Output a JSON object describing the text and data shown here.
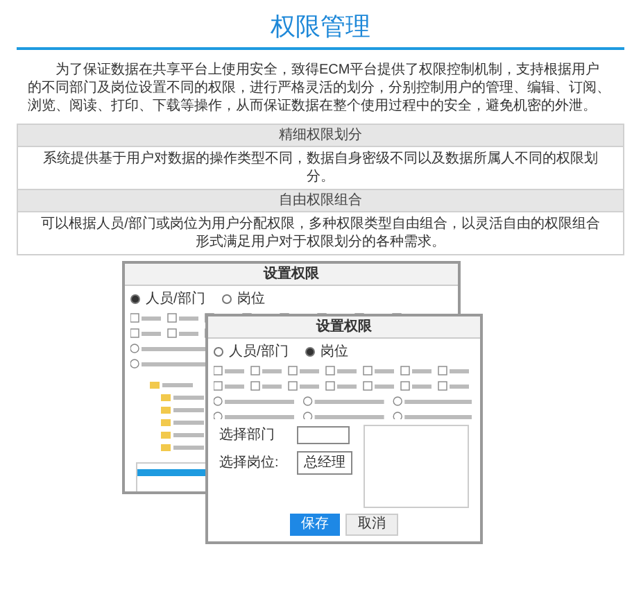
{
  "page": {
    "title": "权限管理",
    "intro": "为了保证数据在共享平台上使用安全，致得ECM平台提供了权限控制机制，支持根据用户的不同部门及岗位设置不同的权限，进行严格灵活的划分，分别控制用户的管理、编辑、订阅、浏览、阅读、打印、下载等操作，从而保证数据在整个使用过程中的安全，避免机密的外泄。"
  },
  "table": {
    "sections": [
      {
        "heading": "精细权限划分",
        "body": "系统提供基于用户对数据的操作类型不同，数据自身密级不同以及数据所属人不同的权限划分。"
      },
      {
        "heading": "自由权限组合",
        "body": "可以根据人员/部门或岗位为用户分配权限，多种权限类型自由组合，以灵活自由的权限组合形式满足用户对于权限划分的各种需求。"
      }
    ]
  },
  "screenshot": {
    "back_dialog": {
      "title": "设置权限",
      "radios": [
        {
          "label": "人员/部门",
          "selected": true
        },
        {
          "label": "岗位",
          "selected": false
        }
      ]
    },
    "front_dialog": {
      "title": "设置权限",
      "radios": [
        {
          "label": "人员/部门",
          "selected": false
        },
        {
          "label": "岗位",
          "selected": true
        }
      ],
      "department_label": "选择部门",
      "position_label": "选择岗位:",
      "position_value": "总经理",
      "buttons": [
        {
          "label": "保存",
          "kind": "primary"
        },
        {
          "label": "取消",
          "kind": "secondary"
        }
      ]
    }
  }
}
